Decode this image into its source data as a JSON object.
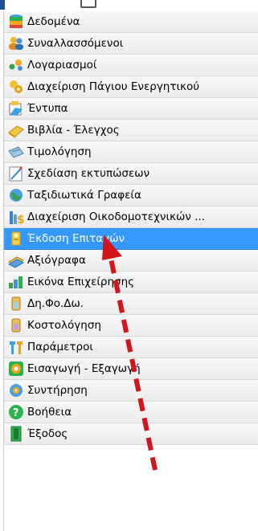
{
  "menu": {
    "selected_index": 10,
    "items": [
      {
        "label": "Δεδομένα",
        "icon": "database-icon"
      },
      {
        "label": "Συναλλασσόμενοι",
        "icon": "users-icon"
      },
      {
        "label": "Λογαριασμοί",
        "icon": "accounts-icon"
      },
      {
        "label": "Διαχείριση Πάγιου Ενεργητικού",
        "icon": "fixed-assets-icon"
      },
      {
        "label": "Έντυπα",
        "icon": "forms-icon"
      },
      {
        "label": "Βιβλία - Έλεγχος",
        "icon": "books-icon"
      },
      {
        "label": "Τιμολόγηση",
        "icon": "invoicing-icon"
      },
      {
        "label": "Σχεδίαση εκτυπώσεων",
        "icon": "print-design-icon"
      },
      {
        "label": "Ταξιδιωτικά Γραφεία",
        "icon": "travel-icon"
      },
      {
        "label": "Διαχείριση Οικοδομοτεχνικών ...",
        "icon": "construction-icon"
      },
      {
        "label": "Έκδοση Επιταγών",
        "icon": "checks-issue-icon"
      },
      {
        "label": "Αξιόγραφα",
        "icon": "securities-icon"
      },
      {
        "label": "Εικόνα Επιχείρησης",
        "icon": "business-overview-icon"
      },
      {
        "label": "Δη.Φο.Δω.",
        "icon": "tax-deduction-icon"
      },
      {
        "label": "Κοστολόγηση",
        "icon": "costing-icon"
      },
      {
        "label": "Παράμετροι",
        "icon": "parameters-icon"
      },
      {
        "label": "Εισαγωγή - Εξαγωγή",
        "icon": "import-export-icon"
      },
      {
        "label": "Συντήρηση",
        "icon": "maintenance-icon"
      },
      {
        "label": "Βοήθεια",
        "icon": "help-icon"
      },
      {
        "label": "Έξοδος",
        "icon": "exit-icon"
      }
    ]
  },
  "colors": {
    "selected_bg": "#3399ff",
    "arrow": "#d4141c"
  }
}
